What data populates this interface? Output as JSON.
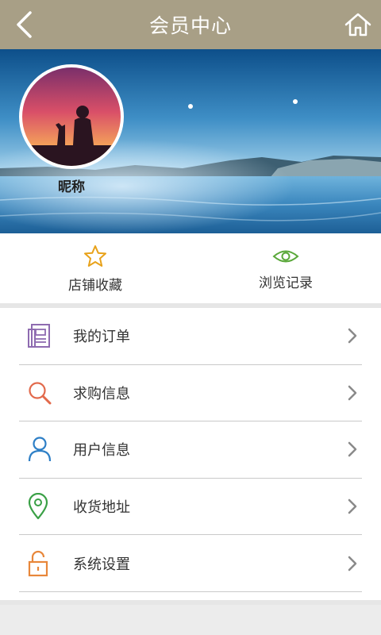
{
  "header": {
    "title": "会员中心",
    "back_icon": "chevron-left-icon",
    "home_icon": "home-icon"
  },
  "profile": {
    "nickname": "昵称"
  },
  "quick_actions": [
    {
      "label": "店铺收藏",
      "icon": "star-icon",
      "color": "#e8a21a"
    },
    {
      "label": "浏览记录",
      "icon": "eye-icon",
      "color": "#5aa83a"
    }
  ],
  "menu": [
    {
      "label": "我的订单",
      "icon": "order-document-icon",
      "color": "#8e6bb0"
    },
    {
      "label": "求购信息",
      "icon": "search-icon",
      "color": "#e26a4c"
    },
    {
      "label": "用户信息",
      "icon": "user-icon",
      "color": "#2e7fc6"
    },
    {
      "label": "收货地址",
      "icon": "location-pin-icon",
      "color": "#3aa046"
    },
    {
      "label": "系统设置",
      "icon": "unlock-icon",
      "color": "#e8873a"
    }
  ],
  "colors": {
    "header_bg": "#a89f86",
    "page_bg": "#e6e6e6",
    "chevron": "#8a8a8a"
  }
}
